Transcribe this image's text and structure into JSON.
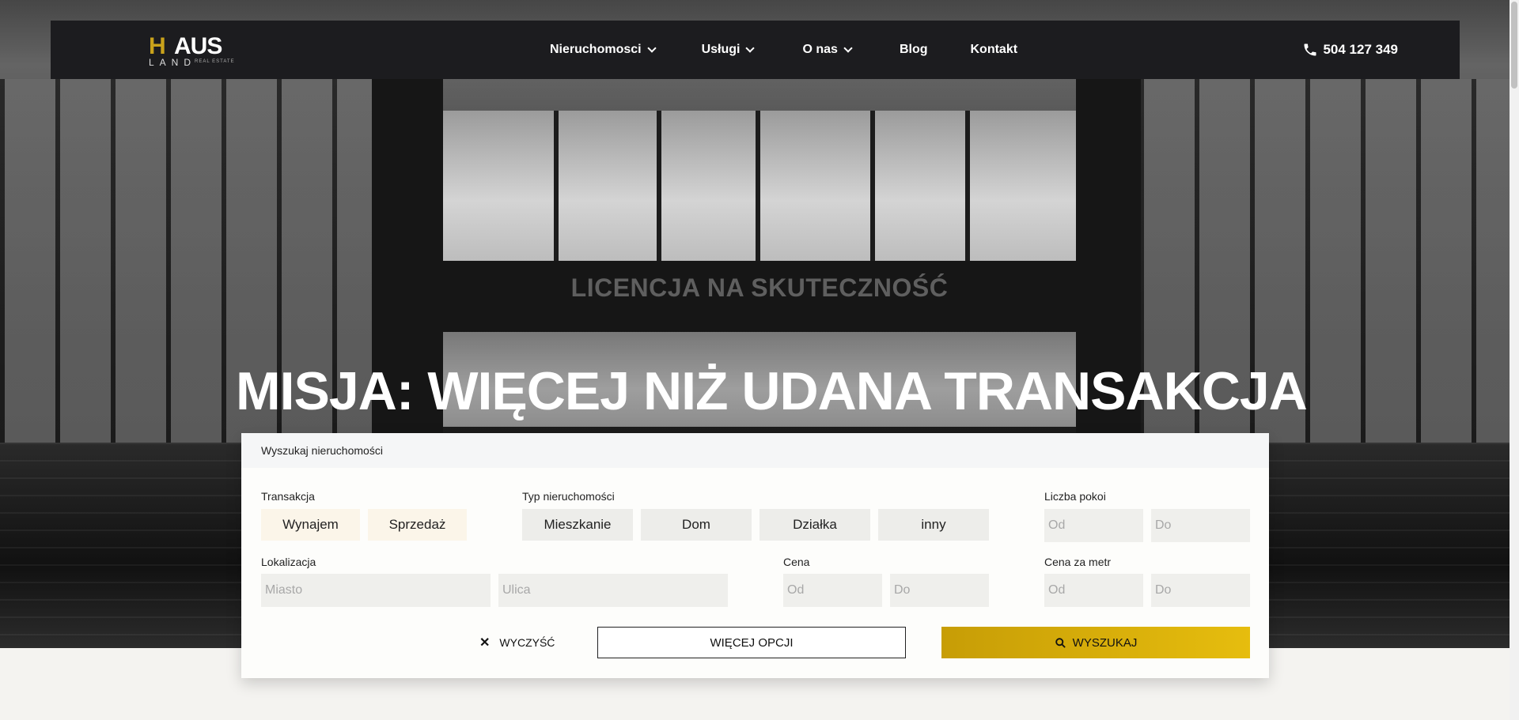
{
  "header": {
    "logo": {
      "mark": "H",
      "word": "AUS",
      "land": "LAND",
      "tag": "REAL ESTATE"
    },
    "menu": [
      {
        "label": "Nieruchomosci",
        "dropdown": true
      },
      {
        "label": "Usługi",
        "dropdown": true
      },
      {
        "label": "O nas",
        "dropdown": true
      },
      {
        "label": "Blog",
        "dropdown": false
      },
      {
        "label": "Kontakt",
        "dropdown": false
      }
    ],
    "phone": "504 127 349"
  },
  "hero": {
    "sign_text": "LICENCJA NA SKUTECZNOŚĆ",
    "headline": "MISJA: WIĘCEJ NIŻ UDANA TRANSAKCJA"
  },
  "search_panel": {
    "title": "Wyszukaj nieruchomości",
    "transaction": {
      "label": "Transakcja",
      "options": [
        "Wynajem",
        "Sprzedaż"
      ]
    },
    "property_type": {
      "label": "Typ nieruchomości",
      "options": [
        "Mieszkanie",
        "Dom",
        "Działka",
        "inny"
      ]
    },
    "rooms": {
      "label": "Liczba pokoi",
      "from_placeholder": "Od",
      "to_placeholder": "Do"
    },
    "location": {
      "label": "Lokalizacja",
      "city_placeholder": "Miasto",
      "street_placeholder": "Ulica"
    },
    "price": {
      "label": "Cena",
      "from_placeholder": "Od",
      "to_placeholder": "Do"
    },
    "price_per_meter": {
      "label": "Cena za metr",
      "from_placeholder": "Od",
      "to_placeholder": "Do"
    },
    "clear_label": "WYCZYŚĆ",
    "more_label": "WIĘCEJ OPCJI",
    "search_label": "WYSZUKAJ"
  },
  "colors": {
    "accent": "#d4ac0d",
    "nav_bg": "#1c1c1f",
    "chip_warm": "#fbf5e9",
    "chip_grey": "#ededea"
  }
}
